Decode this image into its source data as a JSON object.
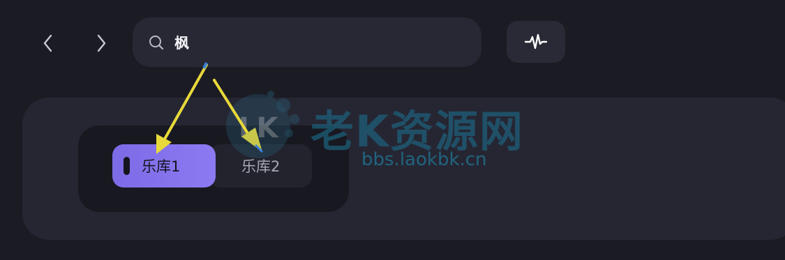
{
  "nav": {
    "back_icon": "chevron-left-icon",
    "forward_icon": "chevron-right-icon"
  },
  "search": {
    "icon": "search-icon",
    "value": "枫"
  },
  "toolbar": {
    "wave_icon": "waveform-icon"
  },
  "library_tabs": [
    {
      "label": "乐库1",
      "active": true
    },
    {
      "label": "乐库2",
      "active": false
    }
  ],
  "watermark": {
    "title": "老K资源网",
    "url": "bbs.laokbk.cn",
    "logo_text": "LK"
  },
  "colors": {
    "background": "#1b1b24",
    "panel": "#262633",
    "accent": "#7c6be6",
    "annotation_arrow": "#e8d93a"
  }
}
